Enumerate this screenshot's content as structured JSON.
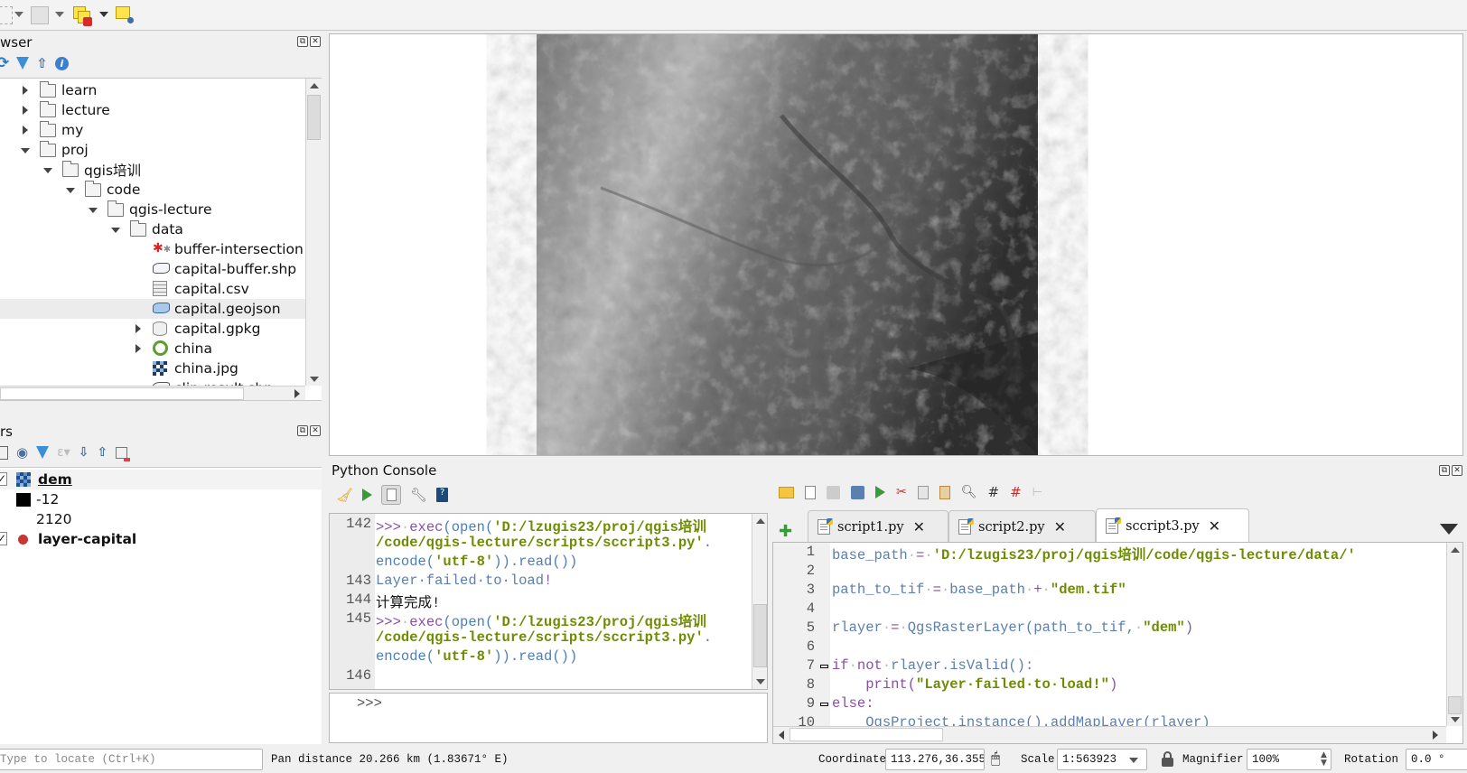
{
  "toolbar": {
    "icons": [
      "select-features-icon",
      "open-attribute-table-icon",
      "deselect-all-icon",
      "identify-features-icon"
    ]
  },
  "browser": {
    "title": "wser",
    "tools": [
      "refresh-icon",
      "filter-icon",
      "collapse-all-icon",
      "info-icon"
    ],
    "items": [
      {
        "label": "learn",
        "indent": 0,
        "state": "collapsed",
        "icon": "folder"
      },
      {
        "label": "lecture",
        "indent": 0,
        "state": "collapsed",
        "icon": "folder"
      },
      {
        "label": "my",
        "indent": 0,
        "state": "collapsed",
        "icon": "folder"
      },
      {
        "label": "proj",
        "indent": 0,
        "state": "expanded",
        "icon": "folder"
      },
      {
        "label": "qgis培训",
        "indent": 1,
        "state": "expanded",
        "icon": "folder"
      },
      {
        "label": "code",
        "indent": 2,
        "state": "expanded",
        "icon": "folder"
      },
      {
        "label": "qgis-lecture",
        "indent": 3,
        "state": "expanded",
        "icon": "folder"
      },
      {
        "label": "data",
        "indent": 4,
        "state": "expanded",
        "icon": "folder"
      },
      {
        "label": "buffer-intersection",
        "indent": 5,
        "state": "leaf",
        "icon": "processing-model"
      },
      {
        "label": "capital-buffer.shp",
        "indent": 5,
        "state": "leaf",
        "icon": "polygon-layer"
      },
      {
        "label": "capital.csv",
        "indent": 5,
        "state": "leaf",
        "icon": "table"
      },
      {
        "label": "capital.geojson",
        "indent": 5,
        "state": "leaf",
        "icon": "polygon-layer-blue",
        "selected": true
      },
      {
        "label": "capital.gpkg",
        "indent": 5,
        "state": "collapsed",
        "icon": "database"
      },
      {
        "label": "china",
        "indent": 5,
        "state": "collapsed",
        "icon": "qgis-project"
      },
      {
        "label": "china.jpg",
        "indent": 5,
        "state": "leaf",
        "icon": "raster"
      },
      {
        "label": "clip-result.shp",
        "indent": 5,
        "state": "leaf",
        "icon": "polygon-layer"
      }
    ]
  },
  "layers": {
    "title": "rs",
    "tools": [
      "add-group-icon",
      "manage-visibility-icon",
      "filter-legend-icon",
      "filter-expression-icon",
      "expand-all-icon",
      "collapse-all-icon",
      "remove-layer-icon"
    ],
    "items": [
      {
        "label": "dem",
        "checked": true,
        "type": "raster",
        "bold": true,
        "underline": true
      },
      {
        "label": "-12",
        "legend": true,
        "swatch": "#000000"
      },
      {
        "label": "2120",
        "legend": true,
        "swatch": null
      },
      {
        "label": "layer-capital",
        "checked": true,
        "type": "point",
        "bold": true,
        "color": "#c83737"
      }
    ]
  },
  "console": {
    "title": "Python Console",
    "tools": [
      "clear-console-icon",
      "run-command-icon",
      "show-editor-icon",
      "options-icon",
      "help-icon"
    ],
    "output": [
      {
        "n": "142",
        "parts": [
          [
            "kw",
            ">>>"
          ],
          [
            "dot",
            "·"
          ],
          [
            "kw",
            "exec"
          ],
          [
            "fn",
            "(open("
          ],
          [
            "str",
            "'D:/lzugis23/proj/qgis培训"
          ]
        ]
      },
      {
        "n": "",
        "parts": [
          [
            "str",
            "/code/qgis-lecture/scripts/sccript3.py'"
          ],
          [
            "fn",
            "."
          ]
        ]
      },
      {
        "n": "",
        "parts": [
          [
            "fn",
            "encode("
          ],
          [
            "str",
            "'utf-8'"
          ],
          [
            "fn",
            ")).read())"
          ]
        ]
      },
      {
        "n": "143",
        "parts": [
          [
            "plain",
            "Layer·failed·to·load"
          ],
          [
            "kw",
            "!"
          ]
        ]
      },
      {
        "n": "144",
        "parts": [
          [
            "black",
            "计算完成!"
          ]
        ]
      },
      {
        "n": "145",
        "parts": [
          [
            "kw",
            ">>>"
          ],
          [
            "dot",
            "·"
          ],
          [
            "kw",
            "exec"
          ],
          [
            "fn",
            "(open("
          ],
          [
            "str",
            "'D:/lzugis23/proj/qgis培训"
          ]
        ]
      },
      {
        "n": "",
        "parts": [
          [
            "str",
            "/code/qgis-lecture/scripts/sccript3.py'"
          ],
          [
            "fn",
            "."
          ]
        ]
      },
      {
        "n": "",
        "parts": [
          [
            "fn",
            "encode("
          ],
          [
            "str",
            "'utf-8'"
          ],
          [
            "fn",
            ")).read())"
          ]
        ]
      },
      {
        "n": "146",
        "parts": []
      }
    ],
    "prompt": ">>>"
  },
  "editor": {
    "tools": [
      "open-script-icon",
      "open-in-external-editor-icon",
      "save-icon",
      "save-as-icon",
      "run-script-icon",
      "cut-icon",
      "copy-icon",
      "paste-icon",
      "find-icon",
      "comment-icon",
      "uncomment-icon",
      "object-inspector-icon"
    ],
    "tabs": [
      {
        "label": "script1.py",
        "active": false
      },
      {
        "label": "script2.py",
        "active": false
      },
      {
        "label": "sccript3.py",
        "active": true
      }
    ],
    "lines": [
      {
        "n": "1",
        "fold": false,
        "parts": [
          [
            "plain",
            "base_path"
          ],
          [
            "dot",
            "·"
          ],
          [
            "kw",
            "="
          ],
          [
            "dot",
            "·"
          ],
          [
            "str",
            "'D:/lzugis23/proj/qgis培训/code/qgis-lecture/data/'"
          ]
        ]
      },
      {
        "n": "2",
        "fold": false,
        "parts": []
      },
      {
        "n": "3",
        "fold": false,
        "parts": [
          [
            "plain",
            "path_to_tif"
          ],
          [
            "dot",
            "·"
          ],
          [
            "kw",
            "="
          ],
          [
            "dot",
            "·"
          ],
          [
            "plain",
            "base_path"
          ],
          [
            "dot",
            "·"
          ],
          [
            "kw",
            "+"
          ],
          [
            "dot",
            "·"
          ],
          [
            "str",
            "\"dem.tif\""
          ]
        ]
      },
      {
        "n": "4",
        "fold": false,
        "parts": []
      },
      {
        "n": "5",
        "fold": false,
        "parts": [
          [
            "plain",
            "rlayer"
          ],
          [
            "dot",
            "·"
          ],
          [
            "kw",
            "="
          ],
          [
            "dot",
            "·"
          ],
          [
            "plain",
            "QgsRasterLayer(path_to_tif,"
          ],
          [
            "dot",
            "·"
          ],
          [
            "str",
            "\"dem\""
          ],
          [
            "kw",
            ")"
          ]
        ]
      },
      {
        "n": "6",
        "fold": false,
        "parts": []
      },
      {
        "n": "7",
        "fold": true,
        "parts": [
          [
            "kw",
            "if"
          ],
          [
            "dot",
            "·"
          ],
          [
            "kw",
            "not"
          ],
          [
            "dot",
            "·"
          ],
          [
            "plain",
            "rlayer.isValid():"
          ]
        ]
      },
      {
        "n": "8",
        "fold": false,
        "parts": [
          [
            "dot",
            "    "
          ],
          [
            "kw",
            "print("
          ],
          [
            "str",
            "\"Layer·failed·to·load!\""
          ],
          [
            "kw",
            ")"
          ]
        ]
      },
      {
        "n": "9",
        "fold": true,
        "parts": [
          [
            "kw",
            "else:"
          ]
        ]
      },
      {
        "n": "10",
        "fold": false,
        "parts": [
          [
            "dot",
            "    "
          ],
          [
            "plain",
            "QgsProject.instance().addMapLayer(rlayer)"
          ]
        ]
      }
    ]
  },
  "status": {
    "locate_placeholder": "Type to locate (Ctrl+K)",
    "message": "Pan distance 20.266 km (1.83671° E)",
    "coordinate_label": "Coordinate",
    "coordinate_value": "113.276,36.355",
    "scale_label": "Scale",
    "scale_value": "1:563923",
    "magnifier_label": "Magnifier",
    "magnifier_value": "100%",
    "rotation_label": "Rotation",
    "rotation_value": "0.0 °"
  }
}
